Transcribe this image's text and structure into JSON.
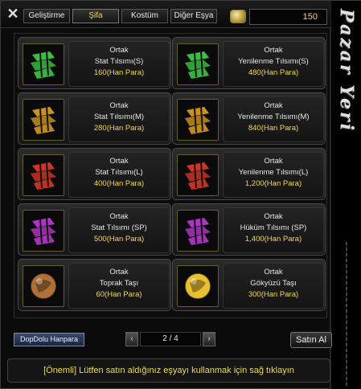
{
  "tabs": [
    {
      "label": "Geliştirme",
      "active": false
    },
    {
      "label": "Şifa",
      "active": true
    },
    {
      "label": "Kostüm",
      "active": false
    },
    {
      "label": "Diğer Eşya",
      "active": false
    }
  ],
  "balance": "150",
  "side_title": "Pazar Yeri",
  "items": [
    {
      "grade": "Ortak",
      "name": "Stat Tılsımı(S)",
      "price": "160(Han Para)",
      "icon": "talisman-green-icon",
      "color": "#3fd14a"
    },
    {
      "grade": "Ortak",
      "name": "Yenilenme Tılsımı(S)",
      "price": "480(Han Para)",
      "icon": "talisman-green-icon",
      "color": "#3fd14a"
    },
    {
      "grade": "Ortak",
      "name": "Stat Tılsımı(M)",
      "price": "280(Han Para)",
      "icon": "talisman-orange-icon",
      "color": "#e0a020"
    },
    {
      "grade": "Ortak",
      "name": "Yenilenme Tılsımı(M)",
      "price": "840(Han Para)",
      "icon": "talisman-orange-icon",
      "color": "#e0a020"
    },
    {
      "grade": "Ortak",
      "name": "Stat Tılsımı(L)",
      "price": "400(Han Para)",
      "icon": "talisman-red-icon",
      "color": "#e23a2a"
    },
    {
      "grade": "Ortak",
      "name": "Yenilenme Tılsımı(L)",
      "price": "1,200(Han Para)",
      "icon": "talisman-red-icon",
      "color": "#e23a2a"
    },
    {
      "grade": "Ortak",
      "name": "Stat Tılsımı (SP)",
      "price": "500(Han Para)",
      "icon": "talisman-purple-icon",
      "color": "#c03ad8"
    },
    {
      "grade": "Ortak",
      "name": "Hüküm Tılsımı (SP)",
      "price": "1,400(Han Para)",
      "icon": "talisman-purple-icon",
      "color": "#c03ad8"
    },
    {
      "grade": "Ortak",
      "name": "Toprak Taşı",
      "price": "60(Han Para)",
      "icon": "earth-stone-icon",
      "color": "#b0703a"
    },
    {
      "grade": "Ortak",
      "name": "Gökyüzü Taşı",
      "price": "300(Han Para)",
      "icon": "sky-stone-icon",
      "color": "#e8c030"
    }
  ],
  "charge_label": "DopDolu Hanpara",
  "page_indicator": "2 / 4",
  "prev_label": "‹",
  "next_label": "›",
  "buy_label": "Satın Al",
  "notice": "[Önemli] Lütfen satın aldığınız eşyayı kullanmak için sağ tıklayın"
}
